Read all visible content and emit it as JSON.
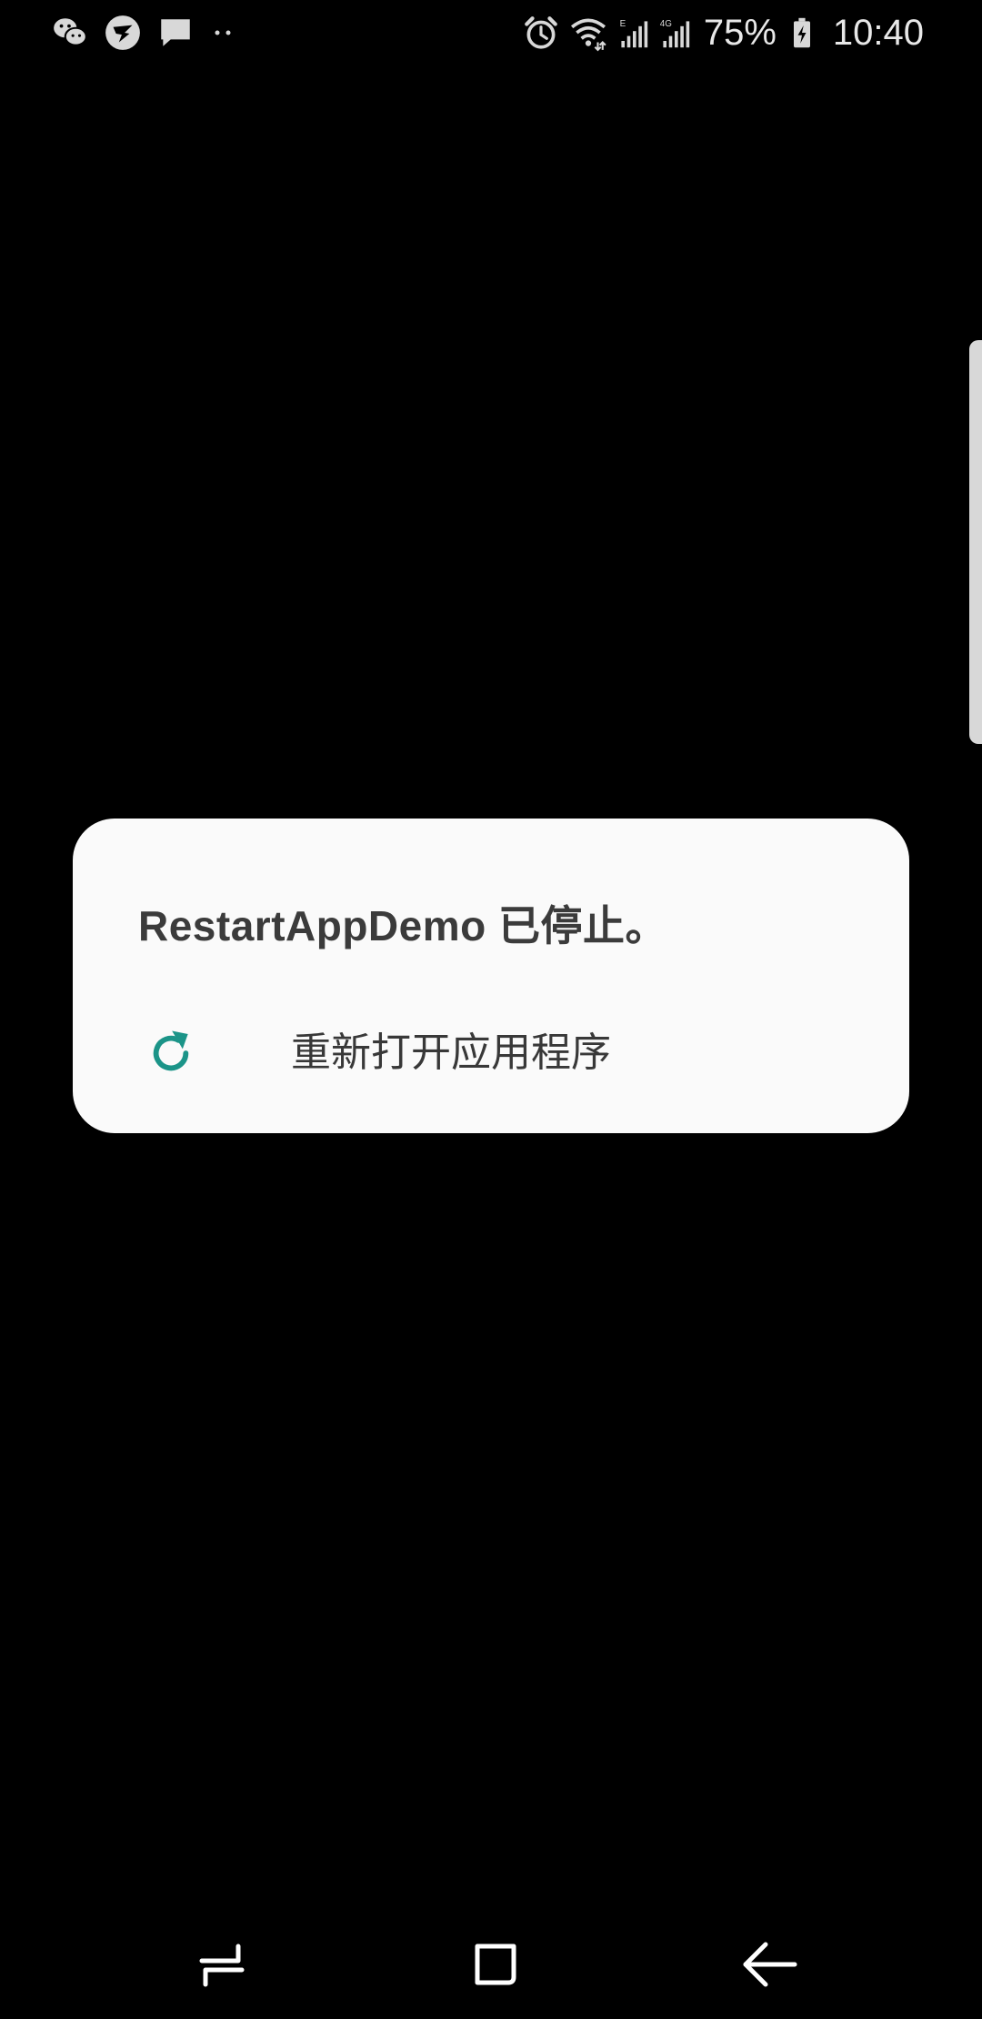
{
  "status_bar": {
    "notification_icons": [
      "wechat-icon",
      "dingtalk-icon",
      "message-icon",
      "more-dots-icon"
    ],
    "system_icons": [
      "alarm-icon",
      "wifi-icon",
      "signal-e-icon",
      "signal-4g-icon"
    ],
    "battery_percent": "75%",
    "time": "10:40"
  },
  "dialog": {
    "title": "RestartAppDemo 已停止。",
    "option": {
      "icon": "refresh-icon",
      "label": "重新打开应用程序"
    }
  },
  "navigation": {
    "buttons": [
      "recents-icon",
      "home-icon",
      "back-icon"
    ]
  },
  "colors": {
    "background": "#000000",
    "dialog_background": "#fafafa",
    "accent": "#1b9488",
    "text": "#383838"
  }
}
